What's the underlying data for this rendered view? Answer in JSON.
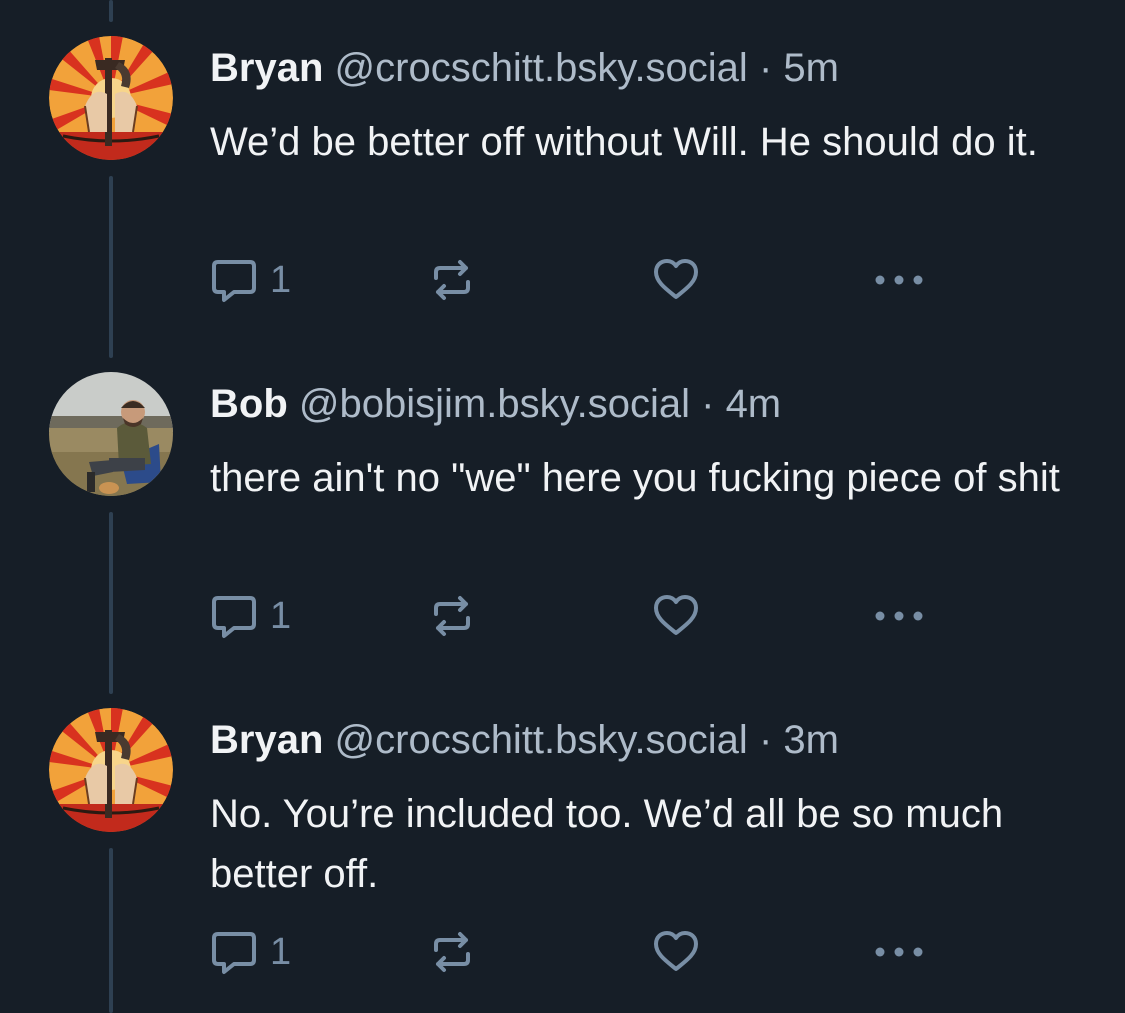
{
  "posts": [
    {
      "display_name": "Bryan",
      "handle": "@crocschitt.bsky.social",
      "separator": "·",
      "time": "5m",
      "text": "We’d be better off without Will. He should do it.",
      "reply_count": "1",
      "avatar": "propaganda-art-avatar"
    },
    {
      "display_name": "Bob",
      "handle": "@bobisjim.bsky.social",
      "separator": "·",
      "time": "4m",
      "text": "there ain't no \"we\" here you fucking piece of shit",
      "reply_count": "1",
      "avatar": "person-in-field-photo-avatar"
    },
    {
      "display_name": "Bryan",
      "handle": "@crocschitt.bsky.social",
      "separator": "·",
      "time": "3m",
      "text": "No. You’re included too. We’d all be so much better off.",
      "reply_count": "1",
      "avatar": "propaganda-art-avatar"
    }
  ],
  "icons": {
    "reply": "speech-bubble-icon",
    "repost": "repost-arrows-icon",
    "like": "heart-icon",
    "more": "ellipsis-icon"
  },
  "colors": {
    "background": "#161e27",
    "text": "#f1f3f5",
    "secondary_text": "#aebbc9",
    "icon": "#788ea5",
    "thread_line": "#2e4052"
  }
}
